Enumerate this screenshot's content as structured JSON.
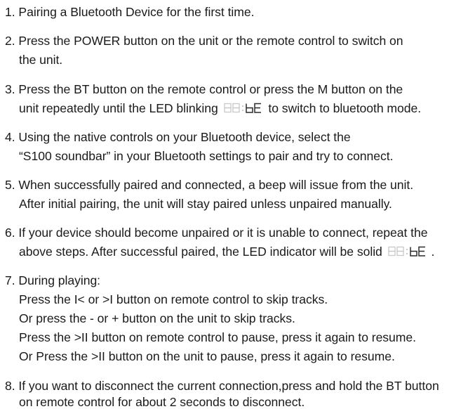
{
  "steps": [
    {
      "lines": [
        "1. Pairing a Bluetooth Device for the first time."
      ]
    },
    {
      "lines": [
        "2. Press the POWER button on the unit or the remote control to switch on",
        "the unit."
      ]
    },
    {
      "lines": [
        "3. Press the BT button on the remote control or press the M button on the",
        "unit repeatedly until the LED  blinking",
        "to switch to bluetooth mode."
      ]
    },
    {
      "lines": [
        "4. Using the native controls on your Bluetooth device, select the",
        "“S100 soundbar” in your Bluetooth settings to pair and try to connect."
      ]
    },
    {
      "lines": [
        "5. When successfully paired and connected, a beep will issue from the unit.",
        "After initial pairing, the unit will stay paired unless unpaired manually."
      ]
    },
    {
      "lines": [
        "6. If your device should become unpaired or it is unable to connect, repeat the",
        "above steps. After successful paired, the LED  indicator will be solid",
        "."
      ]
    },
    {
      "lines": [
        "7. During playing:",
        "Press the I<  or >I  button on remote control to skip tracks.",
        "Or press the - or + button on the unit to skip tracks.",
        "Press the >II button on remote control to pause, press it again to resume.",
        "Or Press the >II button on the unit to pause, press it again to resume."
      ]
    },
    {
      "lines": [
        "8. If you want to disconnect the current connection,press and hold the BT button",
        "on remote control for about 2 seconds to disconnect."
      ]
    }
  ],
  "led_icon": {
    "name": "led-display-bt-icon",
    "dim_color": "#c8c8c8",
    "lit_color": "#2a2a2a"
  }
}
